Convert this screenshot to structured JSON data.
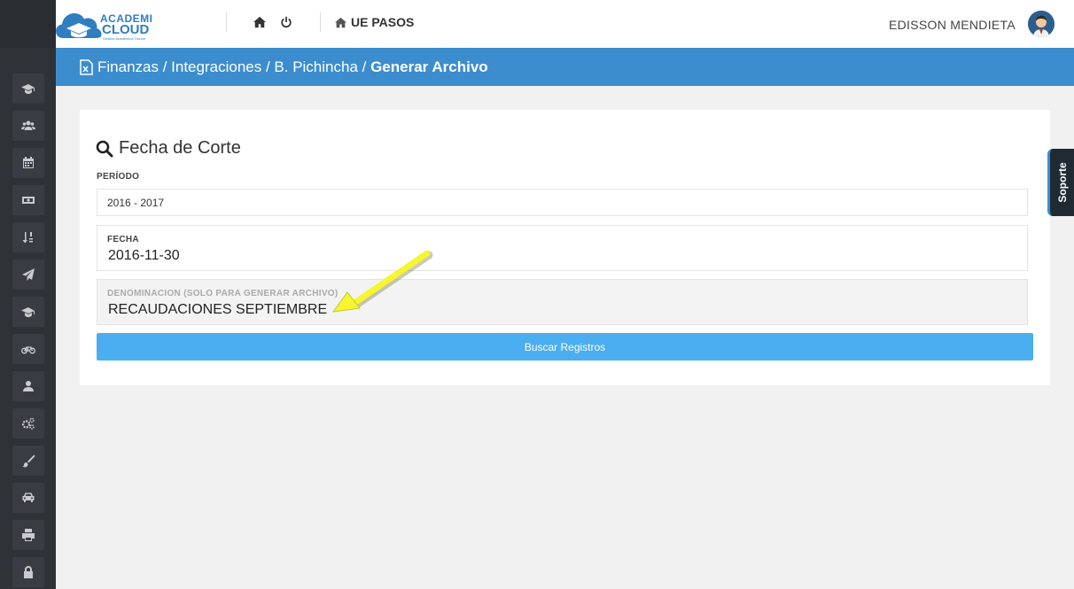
{
  "app": {
    "logo_line1": "ACADEMI",
    "logo_line2": "CLOUD",
    "logo_sub": "Gestión Académica OnLine",
    "school": "UE PASOS",
    "username": "EDISSON MENDIETA"
  },
  "sidebar": {
    "items": [
      {
        "icon": "graduation-cap-icon"
      },
      {
        "icon": "users-icon"
      },
      {
        "icon": "calendar-icon"
      },
      {
        "icon": "money-icon"
      },
      {
        "icon": "sort-icon"
      },
      {
        "icon": "paper-plane-icon"
      },
      {
        "icon": "graduation-cap-icon"
      },
      {
        "icon": "bicycle-icon"
      },
      {
        "icon": "user-icon"
      },
      {
        "icon": "cogs-icon"
      },
      {
        "icon": "paint-brush-icon"
      },
      {
        "icon": "car-icon"
      },
      {
        "icon": "print-icon"
      },
      {
        "icon": "lock-icon"
      }
    ]
  },
  "breadcrumb": {
    "part1": "Finanzas",
    "part2": "Integraciones",
    "part3": "B. Pichincha",
    "sep": " / ",
    "current": "Generar Archivo"
  },
  "form": {
    "title": "Fecha de Corte",
    "periodo_label": "PERÍODO",
    "periodo_value": "2016 - 2017",
    "fecha_label": "FECHA",
    "fecha_value": "2016-11-30",
    "denom_label": "DENOMINACION (SOLO PARA GENERAR ARCHIVO)",
    "denom_value": "RECAUDACIONES SEPTIEMBRE",
    "button": "Buscar Registros"
  },
  "support_tab": "Soporte",
  "colors": {
    "sidebar": "#2f3237",
    "breadcrumb_bar": "#3c8dce",
    "button": "#4aaef0",
    "arrow": "#f5f532"
  }
}
